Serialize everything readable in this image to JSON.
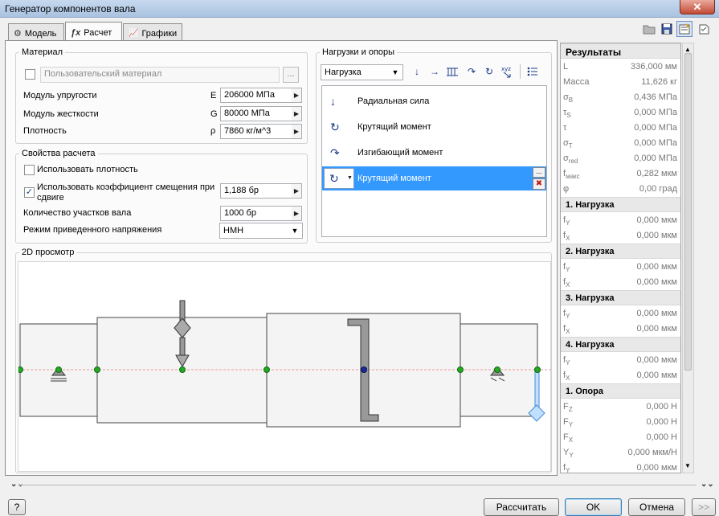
{
  "window": {
    "title": "Генератор компонентов вала",
    "close_glyph": "✕"
  },
  "tabs": [
    {
      "label": "Модель",
      "icon": "model-icon",
      "glyph": "⚙"
    },
    {
      "label": "Расчет",
      "icon": "calculation-icon",
      "glyph": "ƒx"
    },
    {
      "label": "Графики",
      "icon": "graphs-icon",
      "glyph": "📈"
    }
  ],
  "material": {
    "group_label": "Материал",
    "user_material_label": "Пользовательский материал",
    "user_material_checked": false,
    "browse_label": "...",
    "rows": [
      {
        "label": "Модуль упругости",
        "symbol": "E",
        "value": "206000 МПа"
      },
      {
        "label": "Модуль жесткости",
        "symbol": "G",
        "value": "80000 МПа"
      },
      {
        "label": "Плотность",
        "symbol": "ρ",
        "value": "7860 кг/м^3"
      }
    ]
  },
  "calc_props": {
    "group_label": "Свойства расчета",
    "use_density_label": "Использовать плотность",
    "use_density_checked": false,
    "shear_coef_label_1": "Использовать коэффициент смещения при",
    "shear_coef_label_2": "сдвиге",
    "shear_coef_checked": true,
    "shear_coef_value": "1,188 бр",
    "segments_label": "Количество участков вала",
    "segments_value": "1000 бр",
    "stress_mode_label": "Режим приведенного напряжения",
    "stress_mode_value": "HMH"
  },
  "loads": {
    "group_label": "Нагрузки и опоры",
    "type_value": "Нагрузка",
    "items": [
      {
        "label": "Радиальная сила",
        "glyph": "↓",
        "selected": false
      },
      {
        "label": "Крутящий момент",
        "glyph": "↻",
        "selected": false
      },
      {
        "label": "Изгибающий момент",
        "glyph": "↷",
        "selected": false
      },
      {
        "label": "Крутящий момент",
        "glyph": "↻",
        "selected": true
      }
    ],
    "more_label": "...",
    "delete_glyph": "✖"
  },
  "preview": {
    "group_label": "2D просмотр"
  },
  "results": {
    "title": "Результаты",
    "summary": [
      {
        "label": "L",
        "sub": "",
        "value": "336,000 мм"
      },
      {
        "label": "Масса",
        "sub": "",
        "value": "11,626 кг"
      },
      {
        "label": "σ",
        "sub": "B",
        "value": "0,436 МПа"
      },
      {
        "label": "τ",
        "sub": "S",
        "value": "0,000 МПа"
      },
      {
        "label": "τ",
        "sub": "",
        "value": "0,000 МПа"
      },
      {
        "label": "σ",
        "sub": "T",
        "value": "0,000 МПа"
      },
      {
        "label": "σ",
        "sub": "red",
        "value": "0,000 МПа"
      },
      {
        "label": "f",
        "sub": "макс",
        "value": "0,282 мкм"
      },
      {
        "label": "φ",
        "sub": "",
        "value": "0,00 град"
      }
    ],
    "sections": [
      {
        "title": "1. Нагрузка",
        "rows": [
          {
            "label": "f",
            "sub": "Y",
            "value": "0,000 мкм"
          },
          {
            "label": "f",
            "sub": "X",
            "value": "0,000 мкм"
          }
        ]
      },
      {
        "title": "2. Нагрузка",
        "rows": [
          {
            "label": "f",
            "sub": "Y",
            "value": "0,000 мкм"
          },
          {
            "label": "f",
            "sub": "X",
            "value": "0,000 мкм"
          }
        ]
      },
      {
        "title": "3. Нагрузка",
        "rows": [
          {
            "label": "f",
            "sub": "Y",
            "value": "0,000 мкм"
          },
          {
            "label": "f",
            "sub": "X",
            "value": "0,000 мкм"
          }
        ]
      },
      {
        "title": "4. Нагрузка",
        "rows": [
          {
            "label": "f",
            "sub": "Y",
            "value": "0,000 мкм"
          },
          {
            "label": "f",
            "sub": "X",
            "value": "0,000 мкм"
          }
        ]
      },
      {
        "title": "1. Опора",
        "rows": [
          {
            "label": "F",
            "sub": "Z",
            "value": "0,000 Н"
          },
          {
            "label": "F",
            "sub": "Y",
            "value": "0,000 Н"
          },
          {
            "label": "F",
            "sub": "X",
            "value": "0,000 Н"
          },
          {
            "label": "Y",
            "sub": "Y",
            "value": "0,000 мкм/Н"
          },
          {
            "label": "f",
            "sub": "Y",
            "value": "0,000 мкм"
          }
        ]
      }
    ]
  },
  "buttons": {
    "help": "?",
    "calculate": "Рассчитать",
    "ok": "OK",
    "cancel": "Отмена",
    "more": ">>"
  },
  "colors": {
    "accent": "#3399ff",
    "shaft_fill": "#f4f4f4",
    "node_green": "#22aa22",
    "node_blue": "#1a2a9a"
  }
}
